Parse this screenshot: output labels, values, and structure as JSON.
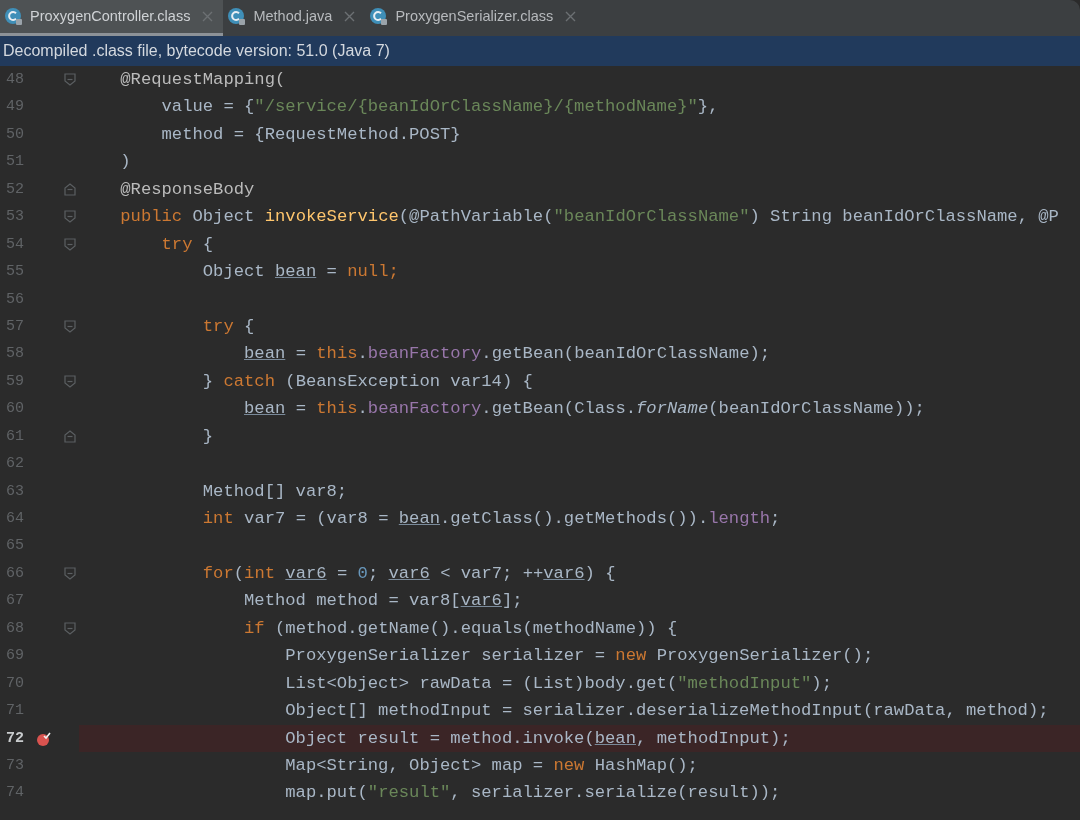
{
  "tabs": [
    {
      "label": "ProxygenController.class",
      "selected": true
    },
    {
      "label": "Method.java",
      "selected": false
    },
    {
      "label": "ProxygenSerializer.class",
      "selected": false
    }
  ],
  "info_bar": {
    "text": "Decompiled .class file, bytecode version: 51.0 (Java 7)"
  },
  "editor": {
    "lines": [
      {
        "number": "48",
        "fold_start": true,
        "tokens": [
          {
            "text": "    @RequestMapping(",
            "kind": "annotation"
          }
        ]
      },
      {
        "number": "49",
        "tokens": [
          {
            "text": "        value = {",
            "kind": "plain"
          },
          {
            "text": "\"/service/{beanIdOrClassName}/{methodName}\"",
            "kind": "string"
          },
          {
            "text": "},",
            "kind": "plain"
          }
        ]
      },
      {
        "number": "50",
        "tokens": [
          {
            "text": "        method = {RequestMethod.POST}",
            "kind": "plain"
          }
        ]
      },
      {
        "number": "51",
        "tokens": [
          {
            "text": "    )",
            "kind": "plain"
          }
        ]
      },
      {
        "number": "52",
        "fold_end": true,
        "tokens": [
          {
            "text": "    @ResponseBody",
            "kind": "annotation"
          }
        ]
      },
      {
        "number": "53",
        "fold_start": true,
        "tokens": [
          {
            "text": "    public",
            "kind": "keyword"
          },
          {
            "text": " Object ",
            "kind": "plain"
          },
          {
            "text": "invokeService",
            "kind": "method"
          },
          {
            "text": "(@PathVariable(",
            "kind": "plain"
          },
          {
            "text": "\"beanIdOrClassName\"",
            "kind": "string"
          },
          {
            "text": ") String beanIdOrClassName, @P",
            "kind": "plain"
          }
        ]
      },
      {
        "number": "54",
        "fold_start": true,
        "tokens": [
          {
            "text": "        try",
            "kind": "keyword"
          },
          {
            "text": " {",
            "kind": "plain"
          }
        ]
      },
      {
        "number": "55",
        "tokens": [
          {
            "text": "            Object ",
            "kind": "plain"
          },
          {
            "text": "bean",
            "kind": "var"
          },
          {
            "text": " = ",
            "kind": "plain"
          },
          {
            "text": "null;",
            "kind": "keyword"
          }
        ]
      },
      {
        "number": "56"
      },
      {
        "number": "57",
        "fold_start": true,
        "tokens": [
          {
            "text": "            try",
            "kind": "keyword"
          },
          {
            "text": " {",
            "kind": "plain"
          }
        ]
      },
      {
        "number": "58",
        "tokens": [
          {
            "text": "                bean",
            "kind": "var"
          },
          {
            "text": " = ",
            "kind": "plain"
          },
          {
            "text": "this",
            "kind": "keyword"
          },
          {
            "text": ".",
            "kind": "plain"
          },
          {
            "text": "beanFactory",
            "kind": "field"
          },
          {
            "text": ".getBean(beanIdOrClassName);",
            "kind": "plain"
          }
        ]
      },
      {
        "number": "59",
        "fold_start": true,
        "tokens": [
          {
            "text": "            } ",
            "kind": "plain"
          },
          {
            "text": "catch",
            "kind": "keyword"
          },
          {
            "text": " (BeansException var14) {",
            "kind": "plain"
          }
        ]
      },
      {
        "number": "60",
        "tokens": [
          {
            "text": "                bean",
            "kind": "var"
          },
          {
            "text": " = ",
            "kind": "plain"
          },
          {
            "text": "this",
            "kind": "keyword"
          },
          {
            "text": ".",
            "kind": "plain"
          },
          {
            "text": "beanFactory",
            "kind": "field"
          },
          {
            "text": ".getBean(Class.",
            "kind": "plain"
          },
          {
            "text": "forName",
            "kind": "static"
          },
          {
            "text": "(beanIdOrClassName));",
            "kind": "plain"
          }
        ]
      },
      {
        "number": "61",
        "fold_end": true,
        "tokens": [
          {
            "text": "            }",
            "kind": "plain"
          }
        ]
      },
      {
        "number": "62"
      },
      {
        "number": "63",
        "tokens": [
          {
            "text": "            Method[] var8;",
            "kind": "plain"
          }
        ]
      },
      {
        "number": "64",
        "tokens": [
          {
            "text": "            int",
            "kind": "keyword"
          },
          {
            "text": " var7 = (var8 = ",
            "kind": "plain"
          },
          {
            "text": "bean",
            "kind": "var"
          },
          {
            "text": ".getClass().getMethods()).",
            "kind": "plain"
          },
          {
            "text": "length",
            "kind": "field"
          },
          {
            "text": ";",
            "kind": "plain"
          }
        ]
      },
      {
        "number": "65"
      },
      {
        "number": "66",
        "fold_start": true,
        "tokens": [
          {
            "text": "            for",
            "kind": "keyword"
          },
          {
            "text": "(",
            "kind": "plain"
          },
          {
            "text": "int ",
            "kind": "keyword"
          },
          {
            "text": "var6",
            "kind": "var"
          },
          {
            "text": " = ",
            "kind": "plain"
          },
          {
            "text": "0",
            "kind": "number"
          },
          {
            "text": "; ",
            "kind": "plain"
          },
          {
            "text": "var6",
            "kind": "var"
          },
          {
            "text": " < var7; ++",
            "kind": "plain"
          },
          {
            "text": "var6",
            "kind": "var"
          },
          {
            "text": ") {",
            "kind": "plain"
          }
        ]
      },
      {
        "number": "67",
        "tokens": [
          {
            "text": "                Method method = var8[",
            "kind": "plain"
          },
          {
            "text": "var6",
            "kind": "var"
          },
          {
            "text": "];",
            "kind": "plain"
          }
        ]
      },
      {
        "number": "68",
        "fold_start": true,
        "tokens": [
          {
            "text": "                if",
            "kind": "keyword"
          },
          {
            "text": " (method.getName().equals(methodName)) {",
            "kind": "plain"
          }
        ]
      },
      {
        "number": "69",
        "tokens": [
          {
            "text": "                    ProxygenSerializer serializer = ",
            "kind": "plain"
          },
          {
            "text": "new",
            "kind": "keyword"
          },
          {
            "text": " ProxygenSerializer();",
            "kind": "plain"
          }
        ]
      },
      {
        "number": "70",
        "tokens": [
          {
            "text": "                    List<Object> rawData = (List)body.get(",
            "kind": "plain"
          },
          {
            "text": "\"methodInput\"",
            "kind": "string"
          },
          {
            "text": ");",
            "kind": "plain"
          }
        ]
      },
      {
        "number": "71",
        "tokens": [
          {
            "text": "                    Object[] methodInput = serializer.deserializeMethodInput(rawData, method);",
            "kind": "plain"
          }
        ]
      },
      {
        "number": "72",
        "breakpoint": true,
        "tokens": [
          {
            "text": "                    Object result = method.invoke(",
            "kind": "plain"
          },
          {
            "text": "bean",
            "kind": "var"
          },
          {
            "text": ", methodInput);",
            "kind": "plain"
          }
        ]
      },
      {
        "number": "73",
        "tokens": [
          {
            "text": "                    Map<String, Object> map = ",
            "kind": "plain"
          },
          {
            "text": "new",
            "kind": "keyword"
          },
          {
            "text": " HashMap();",
            "kind": "plain"
          }
        ]
      },
      {
        "number": "74",
        "tokens": [
          {
            "text": "                    map.put(",
            "kind": "plain"
          },
          {
            "text": "\"result\"",
            "kind": "string"
          },
          {
            "text": ", serializer.serialize(result));",
            "kind": "plain"
          }
        ]
      }
    ]
  }
}
